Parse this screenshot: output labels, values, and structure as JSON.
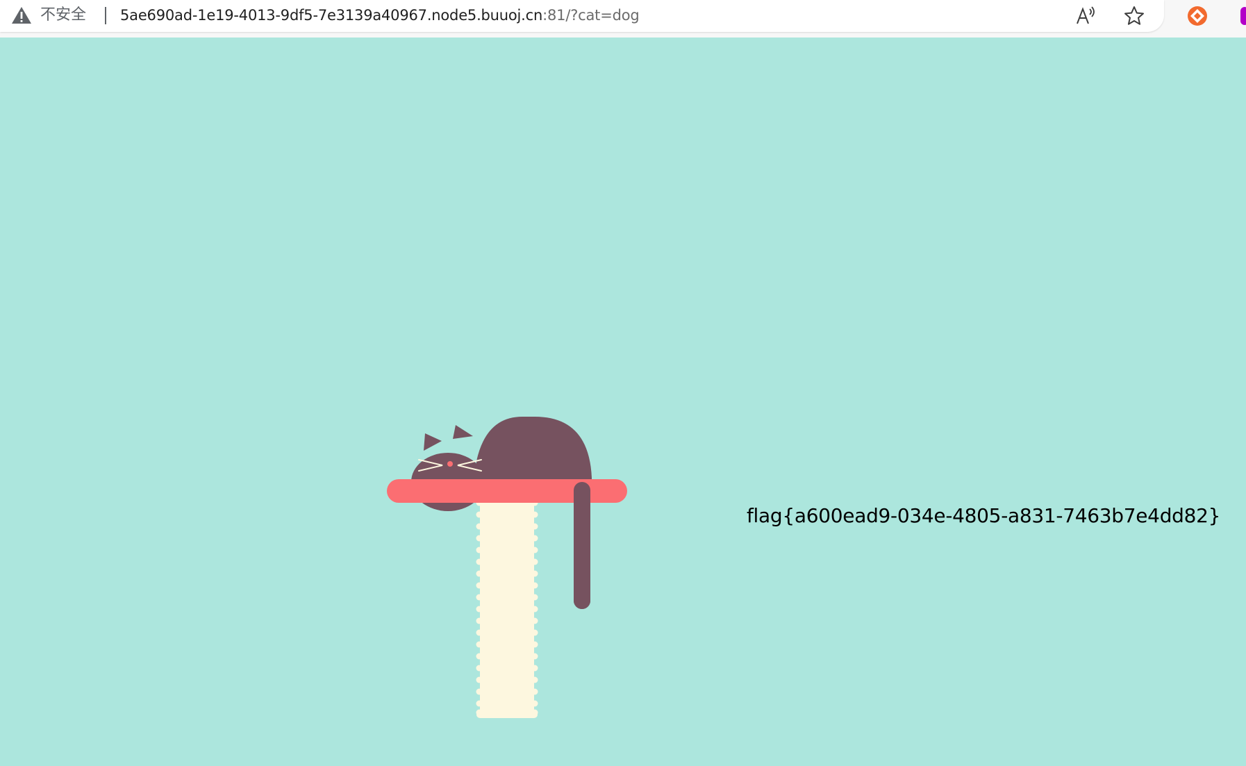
{
  "browser": {
    "security_label": "不安全",
    "url_host": "5ae690ad-1e19-4013-9df5-7e3139a40967.node5.buuoj.cn",
    "url_rest": ":81/?cat=dog",
    "icons": {
      "warning": "warning-triangle-icon",
      "read_aloud": "read-aloud-icon",
      "favorite": "star-icon",
      "extension": "extension-icon"
    }
  },
  "page": {
    "flag_text": "flag{a600ead9-034e-4805-a831-7463b7e4dd82}",
    "colors": {
      "background": "#ACE6DD",
      "cat": "#76525F",
      "shelf": "#FB6E72",
      "post": "#FDF7DF"
    }
  }
}
